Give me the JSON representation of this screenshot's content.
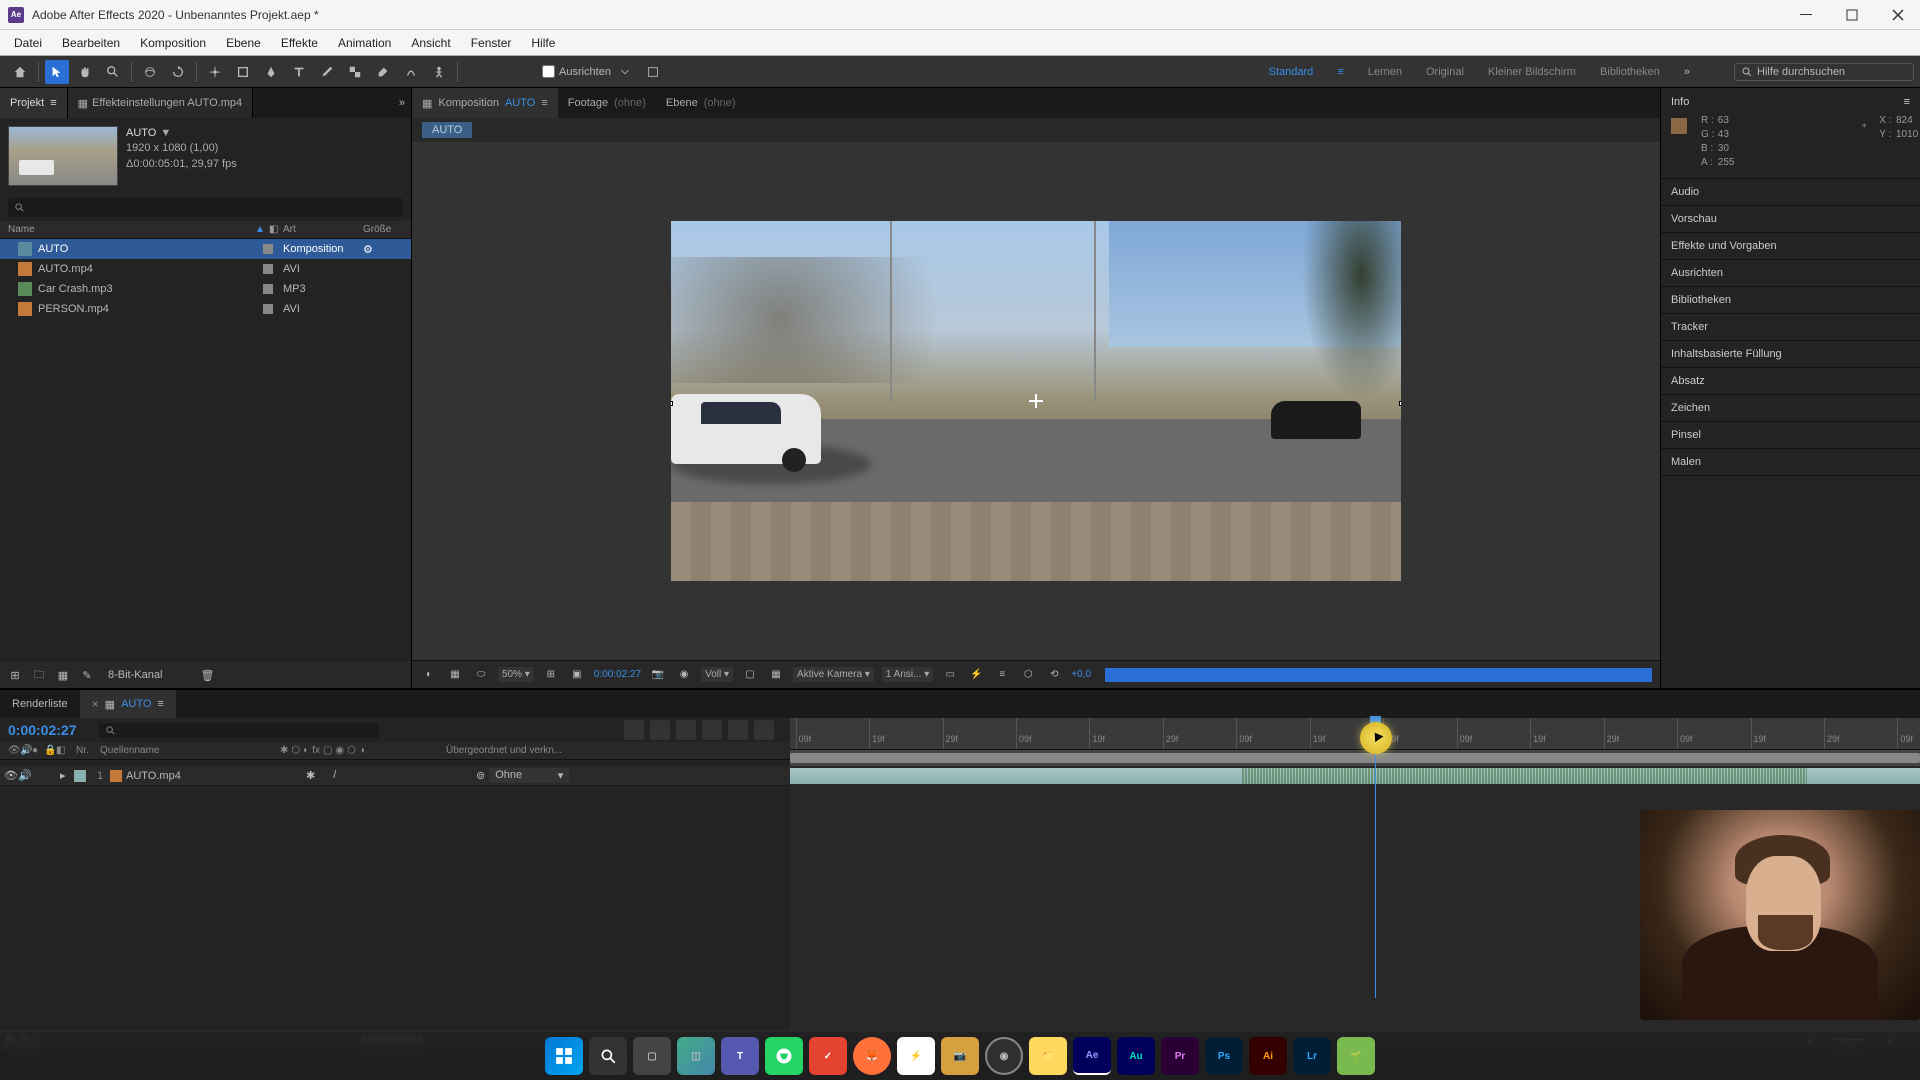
{
  "titlebar": {
    "app_icon": "Ae",
    "title": "Adobe After Effects 2020 - Unbenanntes Projekt.aep *"
  },
  "menubar": [
    "Datei",
    "Bearbeiten",
    "Komposition",
    "Ebene",
    "Effekte",
    "Animation",
    "Ansicht",
    "Fenster",
    "Hilfe"
  ],
  "toolbar": {
    "align_label": "Ausrichten",
    "workspaces": [
      "Standard",
      "Lernen",
      "Original",
      "Kleiner Bildschirm",
      "Bibliotheken"
    ],
    "active_workspace": "Standard",
    "help_placeholder": "Hilfe durchsuchen"
  },
  "project_panel": {
    "tab_project": "Projekt",
    "tab_effects": "Effekteinstellungen AUTO.mp4",
    "selected_name": "AUTO",
    "selected_dims": "1920 x 1080 (1,00)",
    "selected_dur": "Δ0:00:05:01, 29,97 fps",
    "col_name": "Name",
    "col_type": "Art",
    "col_size": "Größe",
    "items": [
      {
        "name": "AUTO",
        "type": "Komposition",
        "icon": "comp"
      },
      {
        "name": "AUTO.mp4",
        "type": "AVI",
        "icon": "vid"
      },
      {
        "name": "Car Crash.mp3",
        "type": "MP3",
        "icon": "aud"
      },
      {
        "name": "PERSON.mp4",
        "type": "AVI",
        "icon": "vid"
      }
    ],
    "footer_text": "8-Bit-Kanal"
  },
  "comp_panel": {
    "tab_comp_prefix": "Komposition",
    "tab_comp_name": "AUTO",
    "tab_footage": "Footage",
    "tab_footage_val": "(ohne)",
    "tab_layer": "Ebene",
    "tab_layer_val": "(ohne)",
    "breadcrumb": "AUTO",
    "zoom": "50%",
    "timecode": "0:00:02:27",
    "resolution": "Voll",
    "camera": "Aktive Kamera",
    "views": "1 Ansi...",
    "exposure": "+0,0"
  },
  "info_panel": {
    "title": "Info",
    "r": "63",
    "g": "43",
    "b": "30",
    "a": "255",
    "x": "824",
    "y": "1010",
    "r_label": "R :",
    "g_label": "G :",
    "b_label": "B :",
    "a_label": "A :",
    "x_label": "X :",
    "y_label": "Y :"
  },
  "side_panels": [
    "Audio",
    "Vorschau",
    "Effekte und Vorgaben",
    "Ausrichten",
    "Bibliotheken",
    "Tracker",
    "Inhaltsbasierte Füllung",
    "Absatz",
    "Zeichen",
    "Pinsel",
    "Malen"
  ],
  "timeline": {
    "tab_render": "Renderliste",
    "tab_comp": "AUTO",
    "timecode": "0:00:02:27",
    "col_nr": "Nr.",
    "col_source": "Quellenname",
    "col_parent": "Übergeordnet und verkn...",
    "ruler_ticks": [
      "09f",
      "19f",
      "29f",
      "09f",
      "19f",
      "29f",
      "09f",
      "19f",
      "29f",
      "09f",
      "19f",
      "29f",
      "09f",
      "19f",
      "29f",
      "09f"
    ],
    "layer_num": "1",
    "layer_name": "AUTO.mp4",
    "parent_value": "Ohne",
    "footer_text": "Schalter/Modi"
  },
  "taskbar": {
    "icons": [
      "win",
      "search",
      "explorer",
      "widgets",
      "teams",
      "whatsapp",
      "todoist",
      "firefox",
      "notion",
      "camera",
      "obs",
      "folder",
      "ae",
      "audition",
      "premiere",
      "photoshop",
      "illustrator",
      "lightroom",
      "misc"
    ]
  }
}
